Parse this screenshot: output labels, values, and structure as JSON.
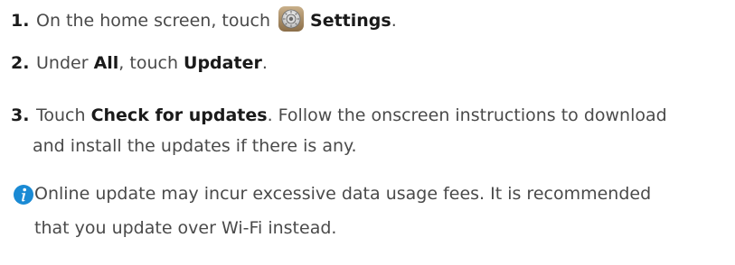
{
  "steps": [
    {
      "number": "1.",
      "text_before": "On the home screen, touch",
      "bold": "Settings",
      "text_after": ".",
      "icon": "settings-gear-icon"
    },
    {
      "number": "2.",
      "text_a": "Under ",
      "bold_a": "All",
      "text_b": ", touch ",
      "bold_b": "Updater",
      "text_c": "."
    },
    {
      "number": "3.",
      "text_a": "Touch ",
      "bold_a": "Check for updates",
      "text_b": ". Follow the onscreen instructions to download",
      "line2": "and install the updates if there is any."
    }
  ],
  "note": {
    "icon": "info-icon",
    "line1": "Online update may incur excessive data usage fees. It is recommended",
    "line2": "that you update over Wi-Fi instead."
  },
  "colors": {
    "text": "#4a4a4a",
    "bold": "#1a1a1a",
    "info_icon": "#1a8ad4"
  }
}
